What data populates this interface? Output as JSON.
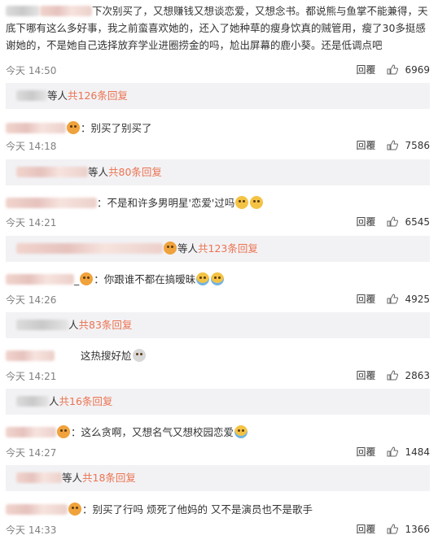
{
  "reply_label": "回覆",
  "colors": {
    "link": "#eb7350",
    "time": "#808080",
    "replybox_bg": "#f2f2f5",
    "text": "#333333"
  },
  "comments": [
    {
      "text": "下次别买了，又想赚钱又想谈恋爱，又想念书。都说熊与鱼掌不能兼得，天底下哪有这么多好事，我之前蛮喜欢她的，还入了她种草的瘦身饮真的贼管用，瘦了30多挺感谢她的，不是她自己选择放弃学业进圈捞金的吗，尬出屏幕的鹿小葵。还是低调点吧",
      "time": "今天 14:50",
      "likes": "6969",
      "replies": {
        "prefix": "等人",
        "count": "共126条回复"
      }
    },
    {
      "text": "：别买了别买了",
      "time": "今天 14:18",
      "likes": "7586",
      "replies": {
        "prefix": "等人",
        "count": "共80条回复"
      }
    },
    {
      "text": "：不是和许多男明星'恋爱'过吗",
      "time": "今天 14:21",
      "likes": "6545",
      "replies": {
        "prefix": "等人",
        "count": "共123条回复"
      }
    },
    {
      "text": "：你跟谁不都在搞暧昧",
      "time": "今天 14:26",
      "likes": "4925",
      "replies": {
        "prefix": "人",
        "count": "共83条回复"
      }
    },
    {
      "text": "这热搜好尬",
      "time": "今天 14:21",
      "likes": "2863",
      "replies": {
        "prefix": "人",
        "count": "共16条回复"
      }
    },
    {
      "text": "：这么贪啊，又想名气又想校园恋爱",
      "time": "今天 14:27",
      "likes": "1484",
      "replies": {
        "prefix": "等人",
        "count": "共18条回复"
      }
    },
    {
      "text": "：别买了行吗 烦死了他妈的 又不是演员也不是歌手",
      "time": "今天 14:33",
      "likes": "1366"
    }
  ]
}
